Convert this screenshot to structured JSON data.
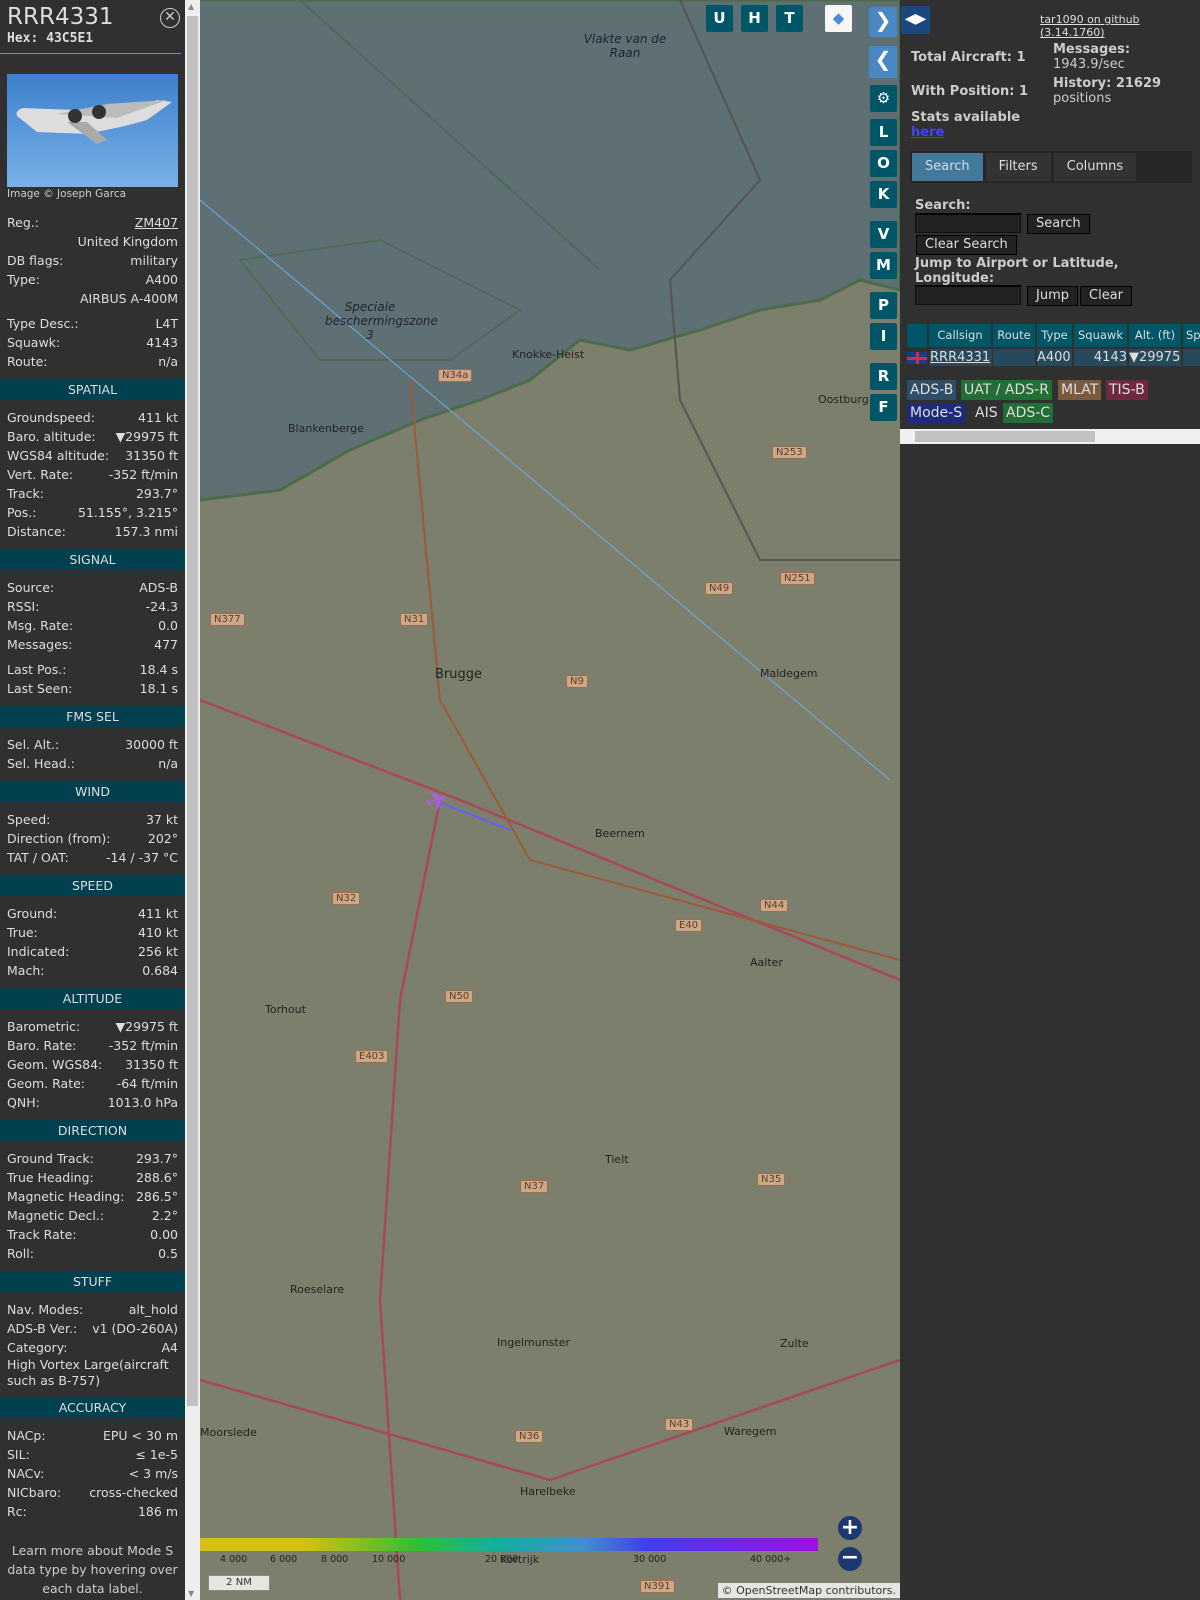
{
  "sidebar": {
    "callsign": "RRR4331",
    "hex": "Hex: 43C5E1",
    "photo_credit": "Image © Joseph Garca",
    "info": [
      {
        "k": "Reg.:",
        "v": "ZM407"
      },
      {
        "k": "",
        "v": "United Kingdom"
      },
      {
        "k": "DB flags:",
        "v": "military"
      },
      {
        "k": "Type:",
        "v": "A400"
      },
      {
        "k": "",
        "v": "AIRBUS A-400M"
      },
      {
        "k": "Type Desc.:",
        "v": "L4T"
      },
      {
        "k": "Squawk:",
        "v": "4143"
      },
      {
        "k": "Route:",
        "v": "n/a"
      }
    ],
    "sections": [
      {
        "title": "SPATIAL",
        "rows": [
          {
            "k": "Groundspeed:",
            "v": "411 kt"
          },
          {
            "k": "Baro. altitude:",
            "v": "▼29975 ft"
          },
          {
            "k": "WGS84 altitude:",
            "v": "31350 ft"
          },
          {
            "k": "Vert. Rate:",
            "v": "-352 ft/min"
          },
          {
            "k": "Track:",
            "v": "293.7°"
          },
          {
            "k": "Pos.:",
            "v": "51.155°, 3.215°"
          },
          {
            "k": "Distance:",
            "v": "157.3 nmi"
          }
        ]
      },
      {
        "title": "SIGNAL",
        "rows": [
          {
            "k": "Source:",
            "v": "ADS-B"
          },
          {
            "k": "RSSI:",
            "v": "-24.3"
          },
          {
            "k": "Msg. Rate:",
            "v": "0.0"
          },
          {
            "k": "Messages:",
            "v": "477"
          },
          {
            "k": "Last Pos.:",
            "v": "18.4 s"
          },
          {
            "k": "Last Seen:",
            "v": "18.1 s"
          }
        ]
      },
      {
        "title": "FMS SEL",
        "rows": [
          {
            "k": "Sel. Alt.:",
            "v": "30000 ft"
          },
          {
            "k": "Sel. Head.:",
            "v": "n/a"
          }
        ]
      },
      {
        "title": "WIND",
        "rows": [
          {
            "k": "Speed:",
            "v": "37 kt"
          },
          {
            "k": "Direction (from):",
            "v": "202°"
          },
          {
            "k": "TAT / OAT:",
            "v": "-14 / -37 °C"
          }
        ]
      },
      {
        "title": "SPEED",
        "rows": [
          {
            "k": "Ground:",
            "v": "411 kt"
          },
          {
            "k": "True:",
            "v": "410 kt"
          },
          {
            "k": "Indicated:",
            "v": "256 kt"
          },
          {
            "k": "Mach:",
            "v": "0.684"
          }
        ]
      },
      {
        "title": "ALTITUDE",
        "rows": [
          {
            "k": "Barometric:",
            "v": "▼29975 ft"
          },
          {
            "k": "Baro. Rate:",
            "v": "-352 ft/min"
          },
          {
            "k": "Geom. WGS84:",
            "v": "31350 ft"
          },
          {
            "k": "Geom. Rate:",
            "v": "-64 ft/min"
          },
          {
            "k": "QNH:",
            "v": "1013.0 hPa"
          }
        ]
      },
      {
        "title": "DIRECTION",
        "rows": [
          {
            "k": "Ground Track:",
            "v": "293.7°"
          },
          {
            "k": "True Heading:",
            "v": "288.6°"
          },
          {
            "k": "Magnetic Heading:",
            "v": "286.5°"
          },
          {
            "k": "Magnetic Decl.:",
            "v": "2.2°"
          },
          {
            "k": "Track Rate:",
            "v": "0.00"
          },
          {
            "k": "Roll:",
            "v": "0.5"
          }
        ]
      },
      {
        "title": "STUFF",
        "rows": [
          {
            "k": "Nav. Modes:",
            "v": "alt_hold"
          },
          {
            "k": "ADS-B Ver.:",
            "v": "v1 (DO-260A)"
          },
          {
            "k": "Category:",
            "v": "A4"
          }
        ],
        "full": "High Vortex Large(aircraft such as B-757)"
      },
      {
        "title": "ACCURACY",
        "rows": [
          {
            "k": "NACp:",
            "v": "EPU < 30 m"
          },
          {
            "k": "SIL:",
            "v": "≤ 1e-5"
          },
          {
            "k": "NACv:",
            "v": "< 3 m/s"
          },
          {
            "k": "NICbaro:",
            "v": "cross-checked"
          },
          {
            "k": "Rc:",
            "v": "186 m"
          }
        ]
      }
    ],
    "note": "Learn more about Mode S data type by hovering over each data label."
  },
  "map": {
    "top_buttons": [
      "U",
      "H",
      "T"
    ],
    "side_buttons": [
      "L",
      "O",
      "K",
      "V",
      "M",
      "P",
      "I",
      "R",
      "F"
    ],
    "places": [
      {
        "n": "Vlakte van de Raan",
        "c": "sea"
      },
      {
        "n": "Speciale beschermingszone 3",
        "c": "sea"
      },
      {
        "n": "Knokke-Heist"
      },
      {
        "n": "Blankenberge"
      },
      {
        "n": "Oostburg"
      },
      {
        "n": "Brugge"
      },
      {
        "n": "Maldegem"
      },
      {
        "n": "Beernem"
      },
      {
        "n": "Aalter"
      },
      {
        "n": "Torhout"
      },
      {
        "n": "Tielt"
      },
      {
        "n": "Roeselare"
      },
      {
        "n": "Ingelmunster"
      },
      {
        "n": "Zulte"
      },
      {
        "n": "Moorslede"
      },
      {
        "n": "Waregem"
      },
      {
        "n": "Harelbeke"
      },
      {
        "n": "Kortrijk"
      }
    ],
    "roads": [
      "N34a",
      "N253",
      "N49",
      "N251",
      "N377",
      "N31",
      "N9",
      "N44",
      "N32",
      "E40",
      "N50",
      "E403",
      "N37",
      "N35",
      "N36",
      "N43",
      "N391"
    ],
    "legend_ticks": [
      "4 000",
      "6 000",
      "8 000",
      "10 000",
      "20 000",
      "30 000",
      "40 000+"
    ],
    "scale": "2 NM",
    "attribution": "© OpenStreetMap contributors."
  },
  "right": {
    "github": "tar1090 on github (3.14.1760)",
    "total_aircraft": "Total Aircraft: 1",
    "with_position": "With Position: 1",
    "messages_label": "Messages:",
    "messages": "1943.9/sec",
    "history_label": "History: 21629",
    "history": "positions",
    "stats": "Stats available",
    "stats_link": "here",
    "tabs": [
      "Search",
      "Filters",
      "Columns"
    ],
    "search_label": "Search:",
    "search_btn": "Search",
    "clear_search_btn": "Clear Search",
    "jump_label": "Jump to Airport or Latitude, Longitude:",
    "jump_btn": "Jump",
    "clear_btn": "Clear",
    "columns": [
      "Callsign",
      "Route",
      "Type",
      "Squawk",
      "Alt. (ft)",
      "Sp"
    ],
    "row": {
      "callsign": "RRR4331",
      "type": "A400",
      "squawk": "4143",
      "alt": "▼29975"
    },
    "badges": [
      "ADS-B",
      "UAT / ADS-R",
      "MLAT",
      "TIS-B",
      "Mode-S",
      "AIS",
      "ADS-C"
    ]
  }
}
